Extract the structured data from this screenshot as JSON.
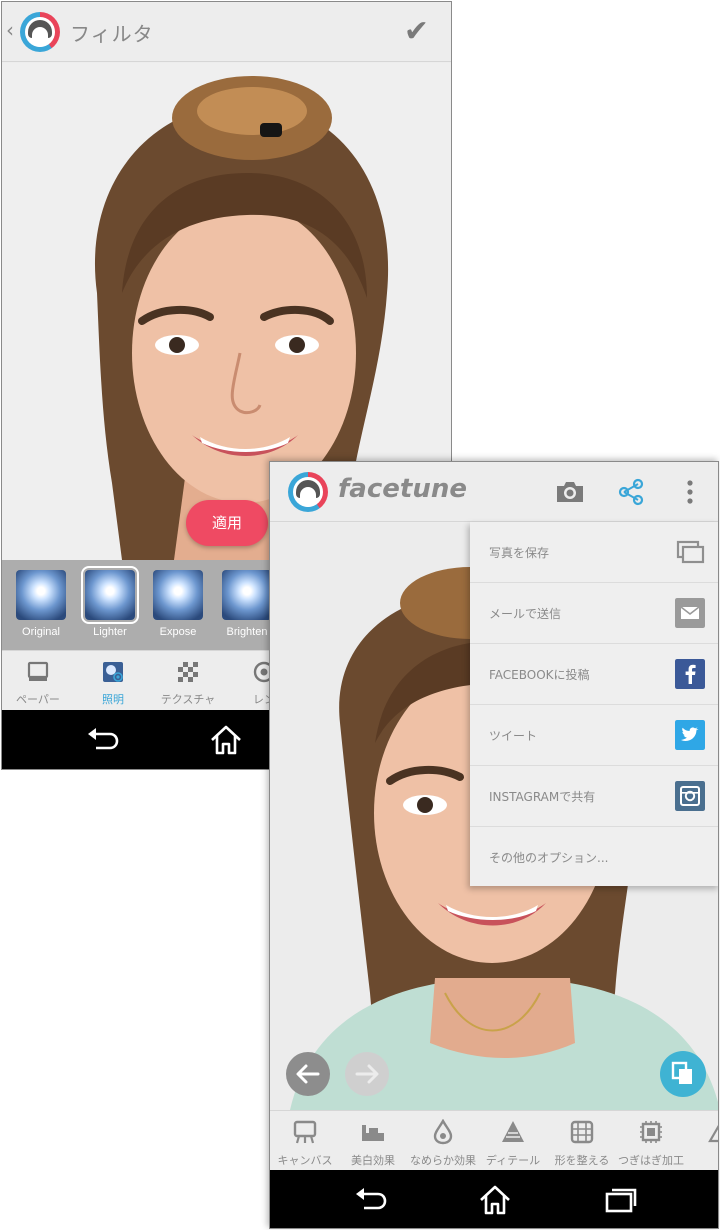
{
  "left_screen": {
    "header": {
      "back_icon": "chevron-left-icon",
      "title": "フィルタ",
      "confirm_icon": "checkmark-icon"
    },
    "apply_label": "適用",
    "filters": [
      {
        "label": "Original",
        "selected": false
      },
      {
        "label": "Lighter",
        "selected": true
      },
      {
        "label": "Expose",
        "selected": false
      },
      {
        "label": "Brighten",
        "selected": false
      }
    ],
    "tools": [
      {
        "label": "ペーパー",
        "icon": "paper-icon",
        "active": false
      },
      {
        "label": "照明",
        "icon": "lighting-icon",
        "active": true
      },
      {
        "label": "テクスチャ",
        "icon": "texture-icon",
        "active": false
      },
      {
        "label": "レン",
        "icon": "lens-icon",
        "active": false
      }
    ],
    "nav": {
      "back_icon": "nav-back-icon",
      "home_icon": "nav-home-icon"
    }
  },
  "right_screen": {
    "header": {
      "brand": "facetune",
      "camera_icon": "camera-icon",
      "share_icon": "share-icon",
      "more_icon": "more-vert-icon"
    },
    "share_menu": [
      {
        "label": "写真を保存",
        "icon": "save-photo-icon",
        "color": "#8f8f8f"
      },
      {
        "label": "メールで送信",
        "icon": "mail-icon",
        "color": "#9a9a9a"
      },
      {
        "label": "FACEBOOKに投稿",
        "icon": "facebook-icon",
        "color": "#3b5998"
      },
      {
        "label": "ツイート",
        "icon": "twitter-icon",
        "color": "#2fa7e6"
      },
      {
        "label": "INSTAGRAMで共有",
        "icon": "instagram-icon",
        "color": "#4a6f8f"
      },
      {
        "label": "その他のオプション...",
        "icon": "",
        "color": ""
      }
    ],
    "tools": [
      {
        "label": "キャンバス",
        "icon": "canvas-icon"
      },
      {
        "label": "美白効果",
        "icon": "whiten-icon"
      },
      {
        "label": "なめらか効果",
        "icon": "smooth-icon"
      },
      {
        "label": "ディテール",
        "icon": "detail-icon"
      },
      {
        "label": "形を整える",
        "icon": "reshape-icon"
      },
      {
        "label": "つぎはぎ加工",
        "icon": "patch-icon"
      },
      {
        "label": "ト",
        "icon": "tone-icon"
      }
    ],
    "nav": {
      "back_icon": "nav-back-icon",
      "home_icon": "nav-home-icon",
      "recents_icon": "nav-recents-icon"
    },
    "accent": "#3aa6d8"
  }
}
